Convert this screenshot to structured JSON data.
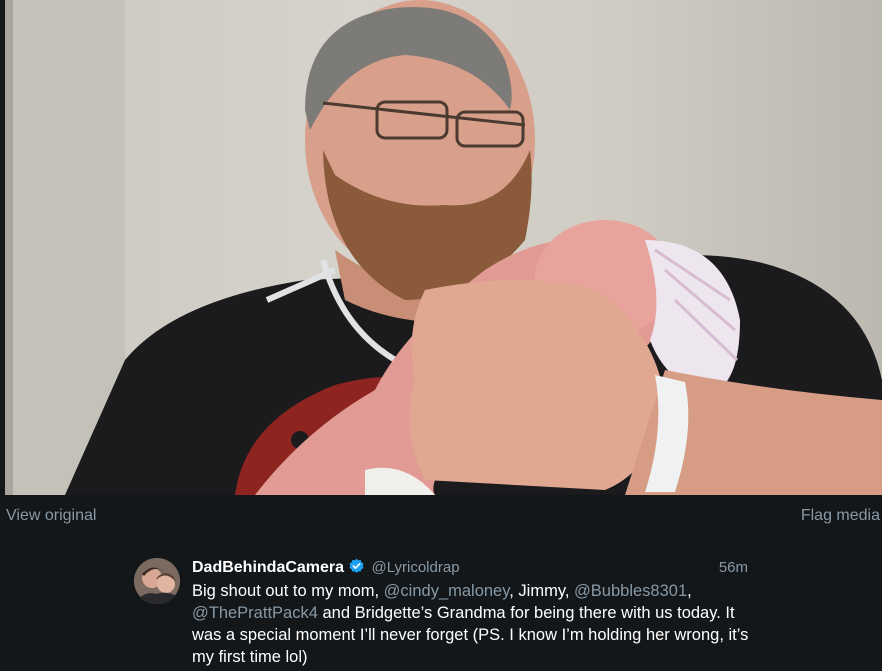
{
  "media": {
    "view_original_label": "View original",
    "flag_media_label": "Flag media"
  },
  "tweet": {
    "display_name": "DadBehindaCamera",
    "handle": "@Lyricoldrap",
    "timestamp": "56m",
    "verified": true,
    "text_segments": [
      {
        "type": "text",
        "value": "Big shout out to my mom, "
      },
      {
        "type": "mention",
        "value": "@cindy_maloney"
      },
      {
        "type": "text",
        "value": ", Jimmy, "
      },
      {
        "type": "mention",
        "value": "@Bubbles8301"
      },
      {
        "type": "text",
        "value": ", "
      },
      {
        "type": "mention",
        "value": "@ThePrattPack4"
      },
      {
        "type": "text",
        "value": " and Bridgette’s Grandma for being there with us today. It was a special moment I’ll never forget (PS. I know I’m holding her wrong, it’s my first time lol)"
      }
    ]
  },
  "colors": {
    "background": "#14171a",
    "muted_text": "#8899a6",
    "primary_text": "#ffffff",
    "verified_badge": "#1da1f2"
  }
}
